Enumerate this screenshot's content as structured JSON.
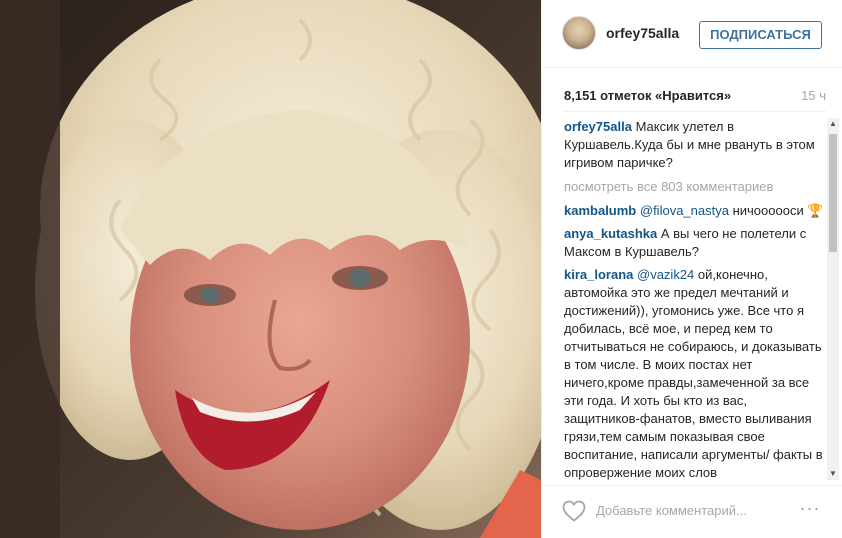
{
  "header": {
    "username": "orfey75alla",
    "follow_label": "ПОДПИСАТЬСЯ"
  },
  "stats": {
    "likes": "8,151 отметок «Нравится»",
    "time": "15 ч"
  },
  "caption": {
    "user": "orfey75alla",
    "text": "Максик улетел в Куршавель.Куда бы и мне рвануть в этом игривом паричке?"
  },
  "view_all": "посмотреть все 803 комментариев",
  "comments": [
    {
      "user": "kambalumb",
      "mention": "@filova_nastya",
      "text": "ничоооооси 🏆"
    },
    {
      "user": "anya_kutashka",
      "mention": "",
      "text": "А вы чего не полетели с Максом в Куршавель?"
    },
    {
      "user": "kira_lorana",
      "mention": "@vazik24",
      "text": "ой,конечно, автомойка это же предел мечтаний и достижений)), угомонись уже. Все что я добилась, всё мое, и перед кем то отчитываться не собираюсь, и доказывать в том числе. В моих постах нет ничего,кроме правды,замеченной за все эти года. И хоть бы кто из вас, защитников-фанатов, вместо выливания грязи,тем самым показывая свое воспитание, написали аргументы/ факты в опровержение моих слов"
    }
  ],
  "footer": {
    "placeholder": "Добавьте комментарий...",
    "more": "···"
  },
  "icons": {
    "heart": "heart-icon",
    "more": "more-options-icon"
  },
  "colors": {
    "link": "#125688",
    "follow": "#3f729b",
    "muted": "#a5a7aa"
  }
}
